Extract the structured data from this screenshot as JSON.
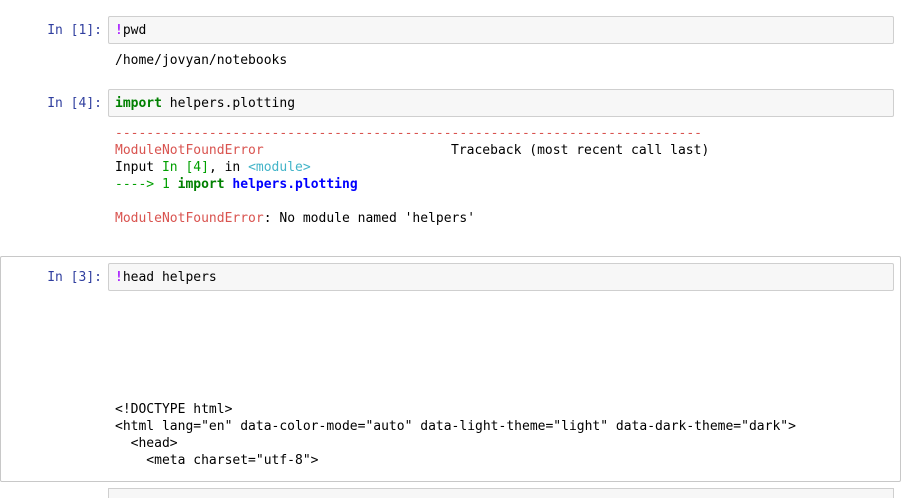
{
  "cells": [
    {
      "prompt": "In [1]:",
      "code": {
        "bang": "!",
        "rest": "pwd"
      },
      "output": "/home/jovyan/notebooks"
    },
    {
      "prompt": "In [4]:",
      "code": {
        "keyword": "import",
        "rest": " helpers.plotting"
      },
      "traceback": {
        "dashes": "---------------------------------------------------------------------------",
        "error_name": "ModuleNotFoundError",
        "traceback_label": "Traceback (most recent call last)",
        "input_prefix": "Input ",
        "input_ref": "In [4]",
        "input_mid": ", in ",
        "module_tag": "<module>",
        "arrow": "----> 1 ",
        "line_keyword": "import",
        "line_module": "helpers.plotting",
        "final_error_name": "ModuleNotFoundError",
        "final_message": ": No module named 'helpers'"
      }
    },
    {
      "prompt": "In [3]:",
      "code": {
        "bang": "!",
        "rest": "head helpers"
      },
      "output_lines": [
        "<!DOCTYPE html>",
        "<html lang=\"en\" data-color-mode=\"auto\" data-light-theme=\"light\" data-dark-theme=\"dark\">",
        "  <head>",
        "    <meta charset=\"utf-8\">"
      ]
    }
  ]
}
